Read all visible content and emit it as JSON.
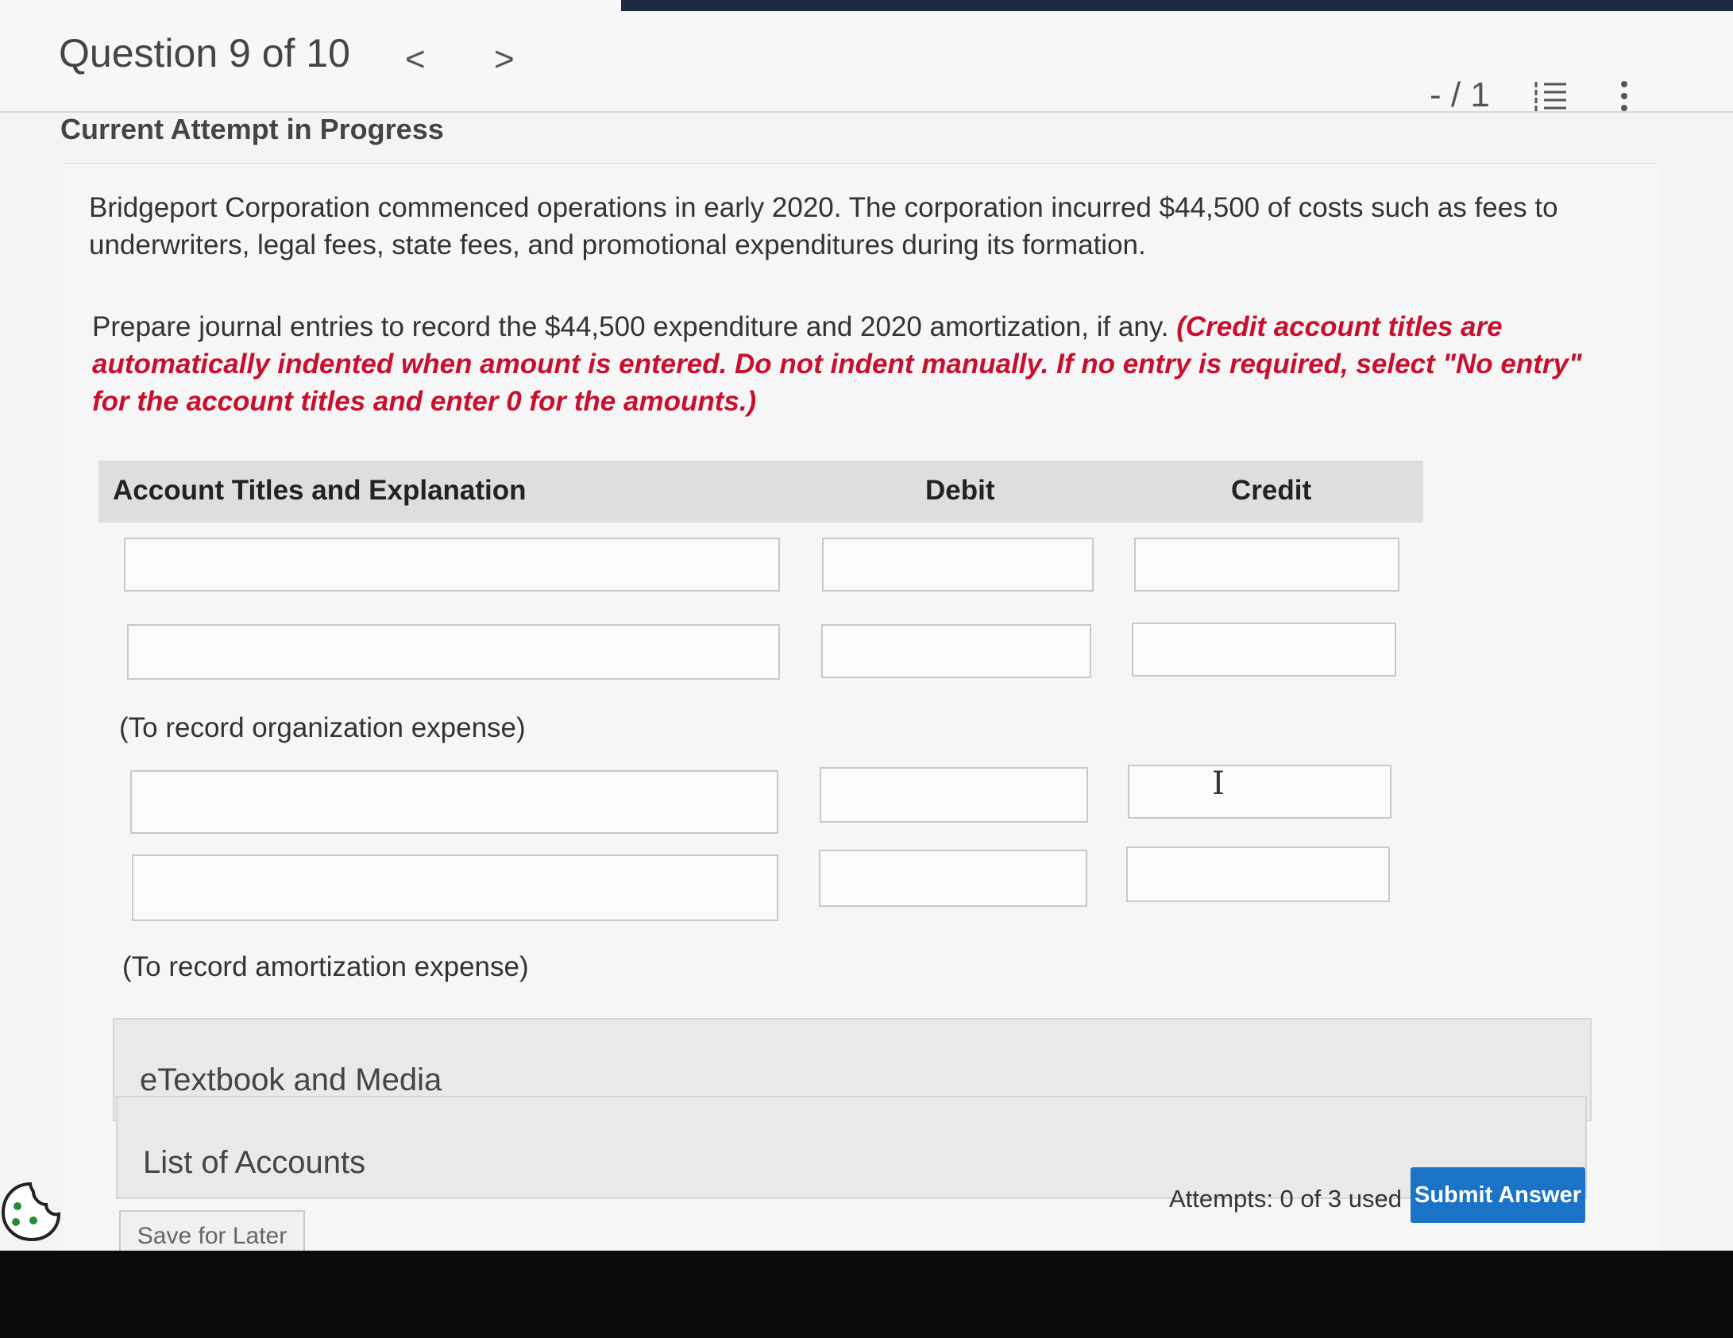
{
  "header": {
    "question_title": "Question 9 of 10",
    "prev_glyph": "<",
    "next_glyph": ">",
    "score": "- / 1",
    "attempt_label": "Current Attempt in Progress"
  },
  "question": {
    "paragraph1": "Bridgeport Corporation commenced operations in early 2020. The corporation incurred $44,500 of costs such as fees to underwriters, legal fees, state fees, and promotional expenditures during its formation.",
    "paragraph2_plain": "Prepare journal entries to record the $44,500 expenditure and 2020 amortization, if any. ",
    "paragraph2_instruction": "(Credit account titles are automatically indented when amount is entered. Do not indent manually. If no entry is required, select \"No entry\" for the account titles and enter 0 for the amounts.)"
  },
  "table": {
    "headers": {
      "account": "Account Titles and Explanation",
      "debit": "Debit",
      "credit": "Credit"
    },
    "entry1_note": "(To record organization expense)",
    "entry2_note": "(To record amortization expense)"
  },
  "panels": {
    "etextbook": "eTextbook and Media",
    "accounts": "List of Accounts"
  },
  "footer": {
    "attempts": "Attempts: 0 of 3 used",
    "submit": "Submit Answer",
    "save": "Save for Later"
  },
  "colors": {
    "accent": "#1a73c7",
    "instruction_red": "#c8102e"
  }
}
